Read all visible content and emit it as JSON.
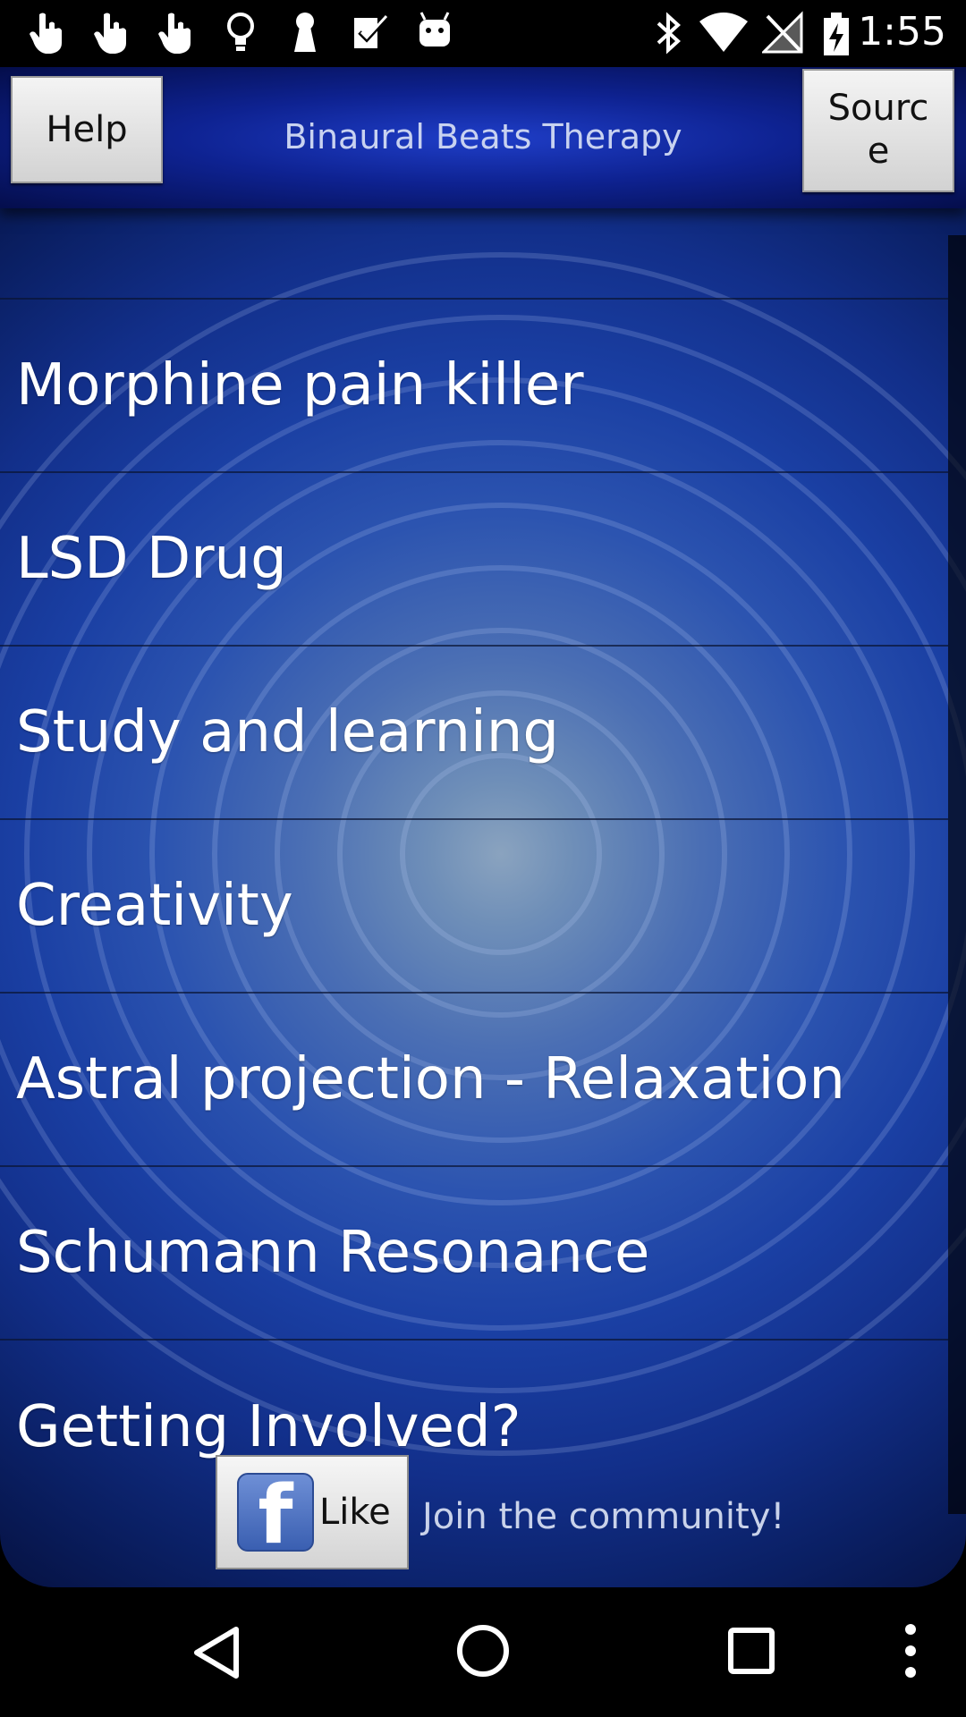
{
  "status_bar": {
    "time": "1:55",
    "notification_icons": [
      "hand-icon",
      "hand-icon",
      "hand-icon",
      "lightbulb-icon",
      "keyhole-icon",
      "checkbox-icon",
      "android-icon"
    ],
    "system_icons": [
      "bluetooth-icon",
      "wifi-icon",
      "no-signal-icon",
      "battery-charging-icon"
    ]
  },
  "header": {
    "title": "Binaural Beats Therapy",
    "help_label": "Help",
    "source_label_line1": "Sourc",
    "source_label_line2": "e"
  },
  "list": {
    "items": [
      {
        "label": "Morphine pain killer"
      },
      {
        "label": "LSD Drug"
      },
      {
        "label": "Study and learning"
      },
      {
        "label": "Creativity"
      },
      {
        "label": "Astral projection - Relaxation"
      },
      {
        "label": "Schumann Resonance"
      },
      {
        "label": "Getting Involved?"
      }
    ]
  },
  "footer": {
    "like_label": "Like",
    "facebook_logo": "f",
    "community_text": "Join the community!"
  },
  "navbar": {
    "icons": [
      "back-icon",
      "home-icon",
      "recents-icon",
      "overflow-menu-icon"
    ]
  },
  "colors": {
    "background_center": "#8aa3bf",
    "background_edge": "#040c33",
    "header": "#0e2291",
    "list_text": "#ffffff"
  }
}
